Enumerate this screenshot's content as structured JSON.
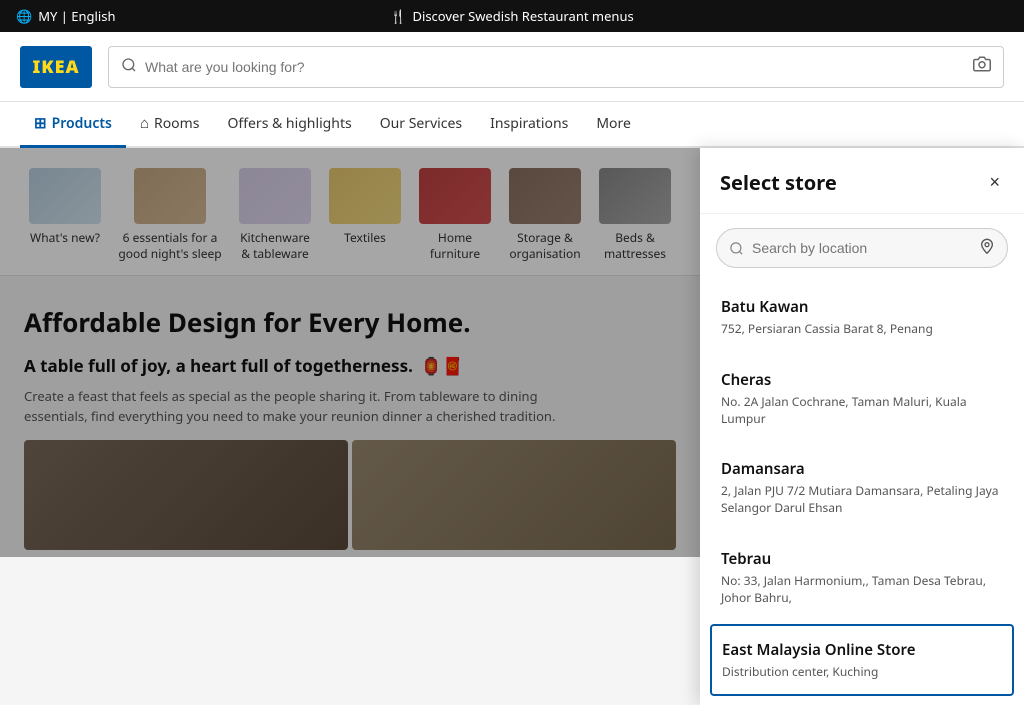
{
  "announcement": {
    "language": "MY | English",
    "promo": "Discover Swedish Restaurant menus",
    "globe_icon": "🌐",
    "fork_icon": "🍴"
  },
  "header": {
    "logo": "IKEA",
    "search_placeholder": "What are you looking for?"
  },
  "nav": {
    "items": [
      {
        "label": "Products",
        "icon": "🛒",
        "active": true
      },
      {
        "label": "Rooms",
        "icon": "🏠",
        "active": false
      },
      {
        "label": "Offers & highlights",
        "icon": "",
        "active": false
      },
      {
        "label": "Our Services",
        "icon": "",
        "active": false
      },
      {
        "label": "Inspirations",
        "icon": "",
        "active": false
      },
      {
        "label": "More",
        "icon": "",
        "active": false
      }
    ]
  },
  "categories": [
    {
      "label": "What's new?",
      "class": "cat-bedding"
    },
    {
      "label": "6 essentials for a good night's sleep",
      "class": "cat-bed"
    },
    {
      "label": "Kitchenware & tableware",
      "class": "cat-tableware"
    },
    {
      "label": "Textiles",
      "class": "cat-textiles"
    },
    {
      "label": "Home furniture",
      "class": "cat-sofa"
    },
    {
      "label": "Storage & organisation",
      "class": "cat-storage"
    },
    {
      "label": "Beds & mattresses",
      "class": "cat-beds"
    }
  ],
  "hero": {
    "headline": "Affordable Design for Every Home.",
    "subheadline": "A table full of joy, a heart full of togetherness.",
    "emojis": "🏮🧧",
    "description": "Create a feast that feels as special as the people sharing it. From tableware to dining essentials, find everything you need to make your reunion dinner a cherished tradition."
  },
  "store_panel": {
    "title": "Select store",
    "search_placeholder": "Search by location",
    "close_label": "×",
    "stores": [
      {
        "name": "Batu Kawan",
        "address": "752, Persiaran Cassia Barat 8, Penang",
        "selected": false
      },
      {
        "name": "Cheras",
        "address": "No. 2A Jalan Cochrane, Taman Maluri, Kuala Lumpur",
        "selected": false
      },
      {
        "name": "Damansara",
        "address": "2, Jalan PJU 7/2 Mutiara Damansara, Petaling Jaya Selangor Darul Ehsan",
        "selected": false
      },
      {
        "name": "Tebrau",
        "address": "No: 33, Jalan Harmonium,, Taman Desa Tebrau, Johor Bahru,",
        "selected": false
      },
      {
        "name": "East Malaysia Online Store",
        "address": "Distribution center, Kuching",
        "selected": true
      }
    ]
  }
}
